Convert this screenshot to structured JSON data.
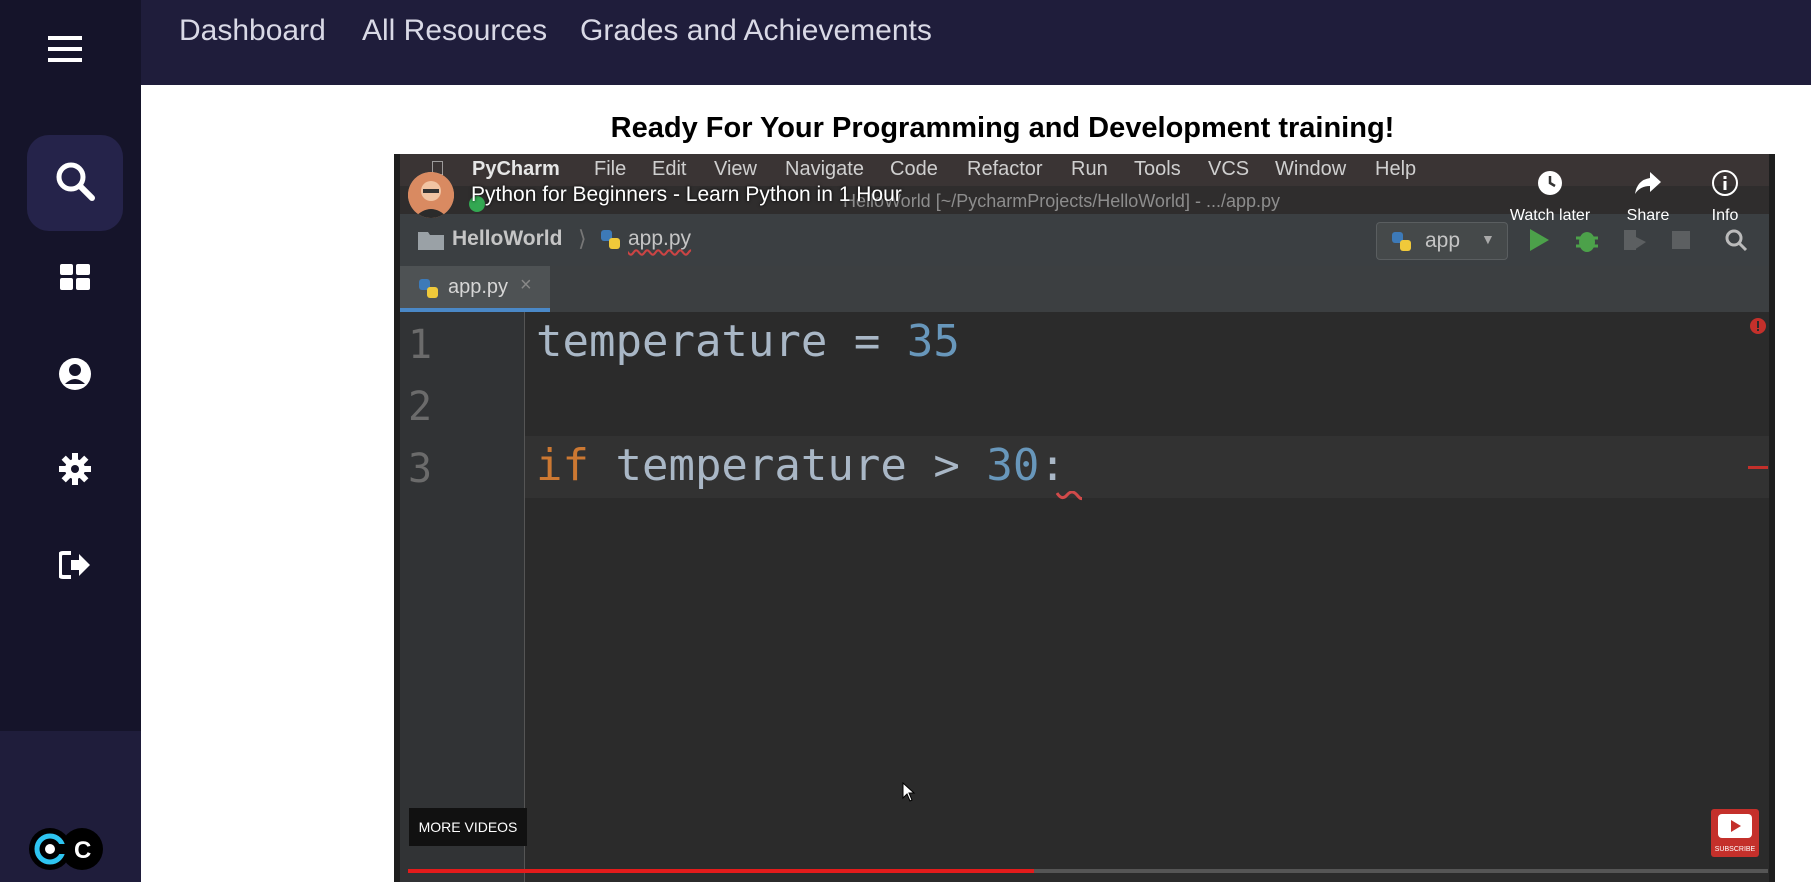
{
  "topnav": {
    "dashboard": "Dashboard",
    "all_resources": "All Resources",
    "grades": "Grades and Achievements"
  },
  "page": {
    "heading": "Ready For Your Programming and Development training!"
  },
  "sidebar": {
    "icons": [
      "menu-icon",
      "search-icon",
      "dashboard-icon",
      "user-icon",
      "gear-icon",
      "logout-icon"
    ],
    "logo_text": "C"
  },
  "video": {
    "title": "Python for Beginners - Learn Python in 1 Hour",
    "watch_later": "Watch later",
    "share": "Share",
    "info": "Info",
    "more_videos": "MORE VIDEOS",
    "subscribe": "SUBSCRIBE",
    "progress_fraction": 0.46
  },
  "ide": {
    "app_name": "PyCharm",
    "menu": [
      "File",
      "Edit",
      "View",
      "Navigate",
      "Code",
      "Refactor",
      "Run",
      "Tools",
      "VCS",
      "Window",
      "Help"
    ],
    "window_title": "HelloWorld [~/PycharmProjects/HelloWorld] - .../app.py",
    "breadcrumb_project": "HelloWorld",
    "breadcrumb_file": "app.py",
    "run_config": "app",
    "tab_label": "app.py",
    "line_numbers": [
      "1",
      "2",
      "3"
    ],
    "code": {
      "line1_var": "temperature",
      "line1_op": " = ",
      "line1_num": "35",
      "line3_kw": "if",
      "line3_var": " temperature > ",
      "line3_num": "30",
      "line3_colon": ":"
    }
  },
  "colors": {
    "sidebar": "#15142a",
    "topbar": "#1f1d3b",
    "keyword": "#cc7832",
    "number": "#6897bb",
    "progress": "#e31b1b"
  }
}
